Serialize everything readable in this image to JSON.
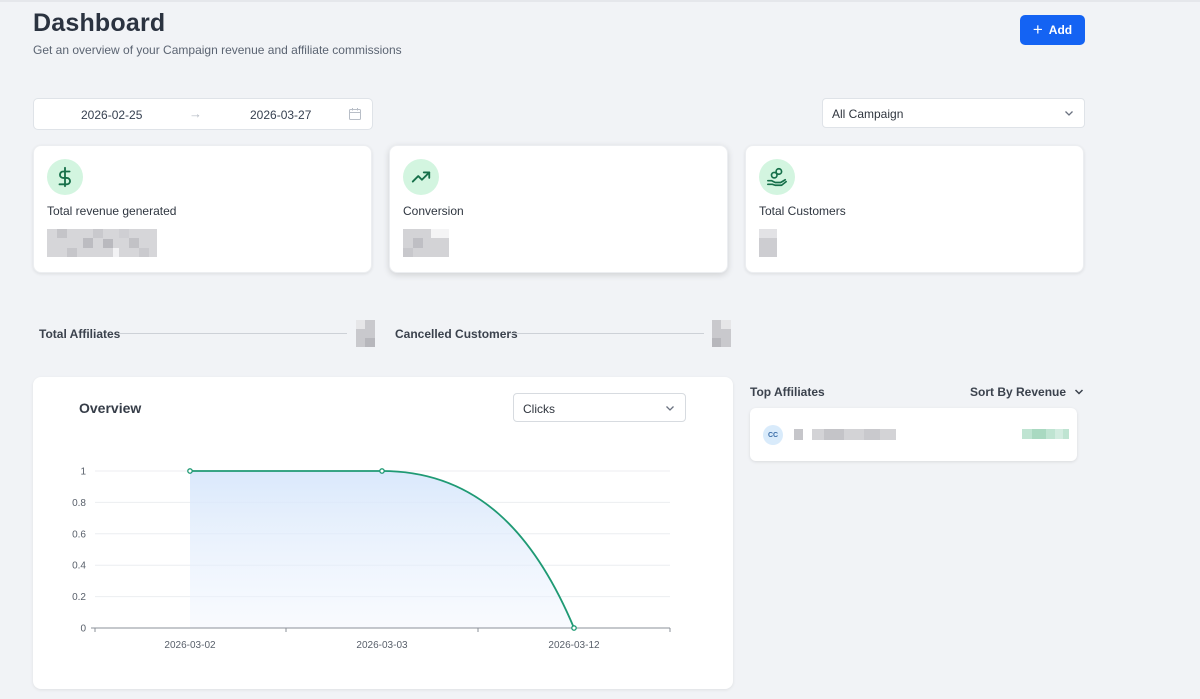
{
  "header": {
    "title": "Dashboard",
    "subtitle": "Get an overview of your Campaign revenue and affiliate commissions",
    "add_button_label": "Add"
  },
  "filters": {
    "date_start": "2026-02-25",
    "date_end": "2026-03-27",
    "campaign_selected": "All Campaign"
  },
  "stats": [
    {
      "label": "Total revenue generated",
      "icon": "dollar-icon"
    },
    {
      "label": "Conversion",
      "icon": "trending-up-icon"
    },
    {
      "label": "Total Customers",
      "icon": "hand-coins-icon"
    }
  ],
  "summary": {
    "affiliates_label": "Total Affiliates",
    "cancelled_label": "Cancelled Customers"
  },
  "overview": {
    "title": "Overview",
    "metric_selected": "Clicks"
  },
  "top_affiliates": {
    "title": "Top Affiliates",
    "sort_label": "Sort By Revenue",
    "items": [
      {
        "initials": "CC"
      }
    ]
  },
  "colors": {
    "accent": "#1463f3",
    "line": "#1f9a74",
    "icon_bg": "#d3f5e0"
  },
  "chart_data": {
    "type": "area",
    "x": [
      "2026-03-02",
      "2026-03-03",
      "2026-03-12"
    ],
    "series": [
      {
        "values": [
          1,
          1,
          0
        ]
      }
    ],
    "title": "",
    "xlabel": "",
    "ylabel": "",
    "ylim": [
      0,
      1
    ],
    "yticks": [
      "0",
      "0.2",
      "0.4",
      "0.6",
      "0.8",
      "1"
    ],
    "grid": true
  }
}
